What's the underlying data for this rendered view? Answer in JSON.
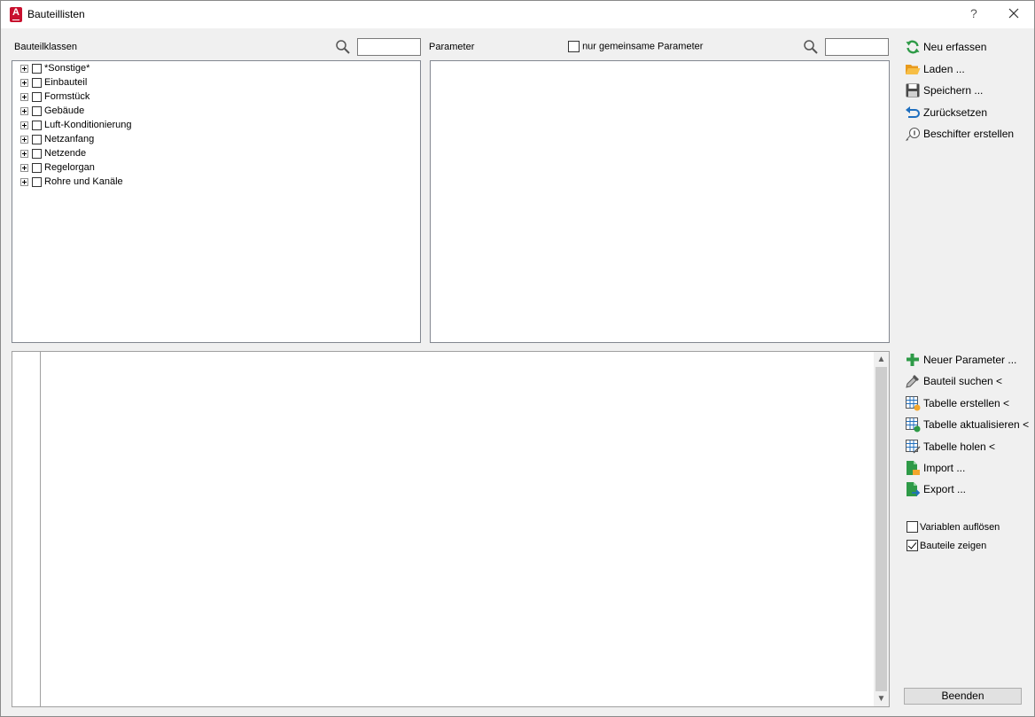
{
  "window": {
    "title": "Bauteillisten",
    "app_logo_letter": "A",
    "help_symbol": "?"
  },
  "classes": {
    "label": "Bauteilklassen",
    "search_value": "",
    "items": [
      {
        "label": "*Sonstige*"
      },
      {
        "label": "Einbauteil"
      },
      {
        "label": "Formstück"
      },
      {
        "label": "Gebäude"
      },
      {
        "label": "Luft-Konditionierung"
      },
      {
        "label": "Netzanfang"
      },
      {
        "label": "Netzende"
      },
      {
        "label": "Regelorgan"
      },
      {
        "label": "Rohre und Kanäle"
      }
    ]
  },
  "parameters": {
    "label": "Parameter",
    "shared_only_label": "nur gemeinsame Parameter",
    "search_value": ""
  },
  "actions_top": {
    "new": "Neu erfassen",
    "load": "Laden ...",
    "save": "Speichern ...",
    "reset": "Zurücksetzen",
    "labeler": "Beschifter erstellen"
  },
  "actions_bottom": {
    "new_param": "Neuer Parameter ...",
    "find_part": "Bauteil suchen <",
    "create_table": "Tabelle erstellen <",
    "update_table": "Tabelle aktualisieren <",
    "get_table": "Tabelle holen <",
    "import": "Import ...",
    "export": "Export ..."
  },
  "options": {
    "resolve_vars": {
      "label": "Variablen auflösen",
      "checked": false
    },
    "show_parts": {
      "label": "Bauteile zeigen",
      "checked": true
    }
  },
  "footer": {
    "close_label": "Beenden"
  },
  "colors": {
    "accent_red": "#c8102e",
    "icon_green": "#2e9a47",
    "icon_blue": "#1f6fbf",
    "folder_orange": "#f2a62c"
  }
}
